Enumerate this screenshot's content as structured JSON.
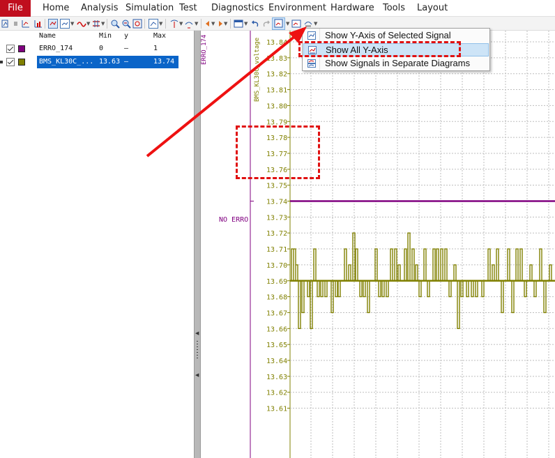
{
  "menu": {
    "items": [
      "File",
      "Home",
      "Analysis",
      "Simulation",
      "Test",
      "Diagnostics",
      "Environment",
      "Hardware",
      "Tools",
      "Layout"
    ]
  },
  "toolbar": {
    "icons": [
      "marker-icon",
      "stop-icon",
      "chart-up-icon",
      "chart-bar-icon",
      "graph-mode-icon",
      "graph-type-icon",
      "curve-icon",
      "measure-icon",
      "zoom-in-icon",
      "zoom-out-icon",
      "zoom-fit-icon",
      "axis-icon",
      "cursor-icon",
      "cursor-2-icon",
      "prev-icon",
      "next-icon",
      "layout-icon",
      "undo-icon",
      "redo-icon",
      "y-axis-menu-icon",
      "window-icon",
      "export-icon"
    ]
  },
  "signal_list": {
    "headers": {
      "name": "Name",
      "min": "Min",
      "y": "y",
      "max": "Max"
    },
    "rows": [
      {
        "name": "ERRO_174",
        "min": "0",
        "y": "–",
        "max": "1",
        "color": "#800080",
        "checked": true,
        "selected": false
      },
      {
        "name": "BMS_KL30C_...",
        "min": "13.63",
        "y": "–",
        "max": "13.74",
        "color": "#808000",
        "checked": true,
        "selected": true
      }
    ]
  },
  "plot": {
    "axis1_label": "ERRO_174",
    "axis2_label": "BMS_KL30C_voltage",
    "errolevel_label": "NO ERRO",
    "y_ticks": [
      "13.84",
      "13.83",
      "13.82",
      "13.81",
      "13.80",
      "13.79",
      "13.78",
      "13.77",
      "13.76",
      "13.75",
      "13.74",
      "13.73",
      "13.72",
      "13.71",
      "13.70",
      "13.69",
      "13.68",
      "13.67",
      "13.66",
      "13.65",
      "13.64",
      "13.63",
      "13.62",
      "13.61"
    ],
    "colors": {
      "erro": "#800080",
      "voltage": "#808000",
      "grid": "#bdbdbd",
      "background": "#ffffff"
    }
  },
  "chart_data": {
    "type": "line",
    "series": [
      {
        "name": "ERRO_174",
        "constant": 13.74
      },
      {
        "name": "BMS_KL30C_voltage",
        "baseline": 13.69,
        "min": 13.66,
        "max": 13.72
      }
    ],
    "ylim": [
      13.61,
      13.845
    ]
  },
  "dropdown": {
    "items": [
      {
        "label": "Show Y-Axis of Selected Signal",
        "icon": "y-axis-selected-icon",
        "selected": false
      },
      {
        "label": "Show All Y-Axis",
        "icon": "y-axis-all-icon",
        "selected": true
      },
      {
        "label": "Show Signals in Separate Diagrams",
        "icon": "separate-diagrams-icon",
        "selected": false
      }
    ]
  },
  "colors": {
    "accent_red": "#c00e1e",
    "annotation": "#e01010",
    "selection": "#0a64c8"
  }
}
